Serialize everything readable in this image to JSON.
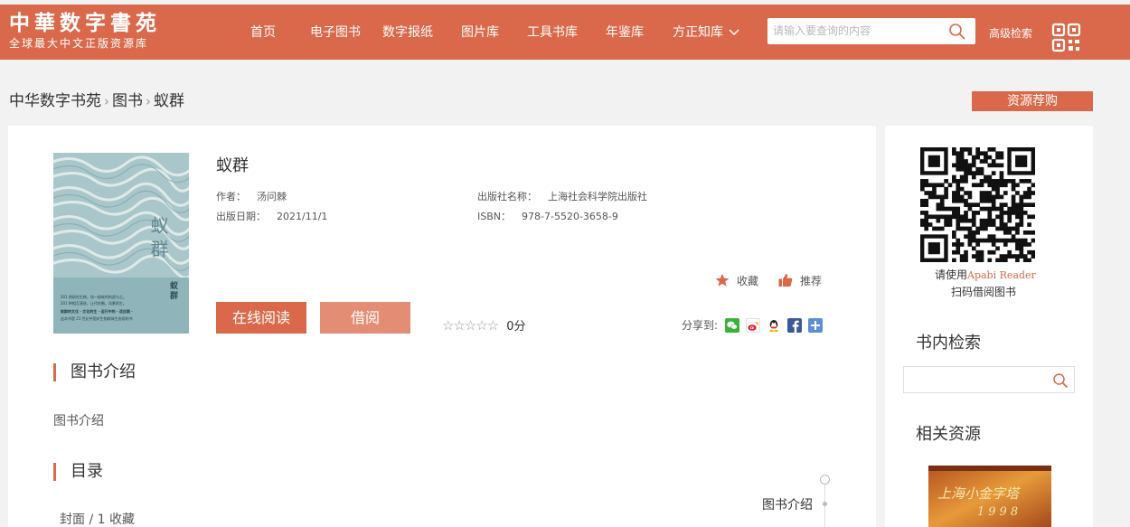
{
  "header": {
    "logo_title": "中華数字書苑",
    "logo_subtitle": "全球最大中文正版资源库",
    "nav": [
      {
        "label": "首页"
      },
      {
        "label": "电子图书"
      },
      {
        "label": "数字报纸"
      },
      {
        "label": "图片库"
      },
      {
        "label": "工具书库"
      },
      {
        "label": "年鉴库"
      },
      {
        "label": "方正知库"
      }
    ],
    "search_placeholder": "请输入要查询的内容",
    "advanced_search": "高级检索"
  },
  "breadcrumb": [
    "中华数字书苑",
    "图书",
    "蚁群"
  ],
  "recommend_button": "资源荐购",
  "book": {
    "title": "蚁群",
    "author_label": "作者：",
    "author": "汤问棘",
    "publisher_label": "出版社名称：",
    "publisher": "上海社会科学院出版社",
    "date_label": "出版日期：",
    "date": "2021/11/1",
    "isbn_label": "ISBN：",
    "isbn": "978-7-5520-3658-9",
    "cover_title": "蚁群",
    "cover_title_small": "蚁群",
    "cover_text": [
      "201 例研究生物，如一枚蚁的构造与之。",
      "201 种相互演进，让代的圈。风景再生。",
      "蚁群的文化 · 文化的生 · 运行中的 · 适应期 ·",
      "这本书是 21 世纪中国对生物群体生态观的书"
    ]
  },
  "actions": {
    "collect": "收藏",
    "recommend": "推荐",
    "read_online": "在线阅读",
    "borrow": "借阅",
    "rating": 0,
    "score": "0分",
    "share_label": "分享到:"
  },
  "sections": {
    "intro_heading": "图书介绍",
    "intro_text": "图书介绍",
    "toc_heading": "目录",
    "toc_first": "封面 / 1 收藏",
    "toc_side": "图书介绍"
  },
  "sidebar": {
    "qr_text_prefix": "请使用",
    "qr_app": "Apabi Reader",
    "qr_text2": "扫码借阅图书",
    "inbook_search": "书内检索",
    "related": "相关资源",
    "related_cover_title": "上海小金字塔",
    "related_cover_year": "1998"
  },
  "colors": {
    "brand": "#d9694a",
    "brand_light": "#e28d74",
    "background": "#f2f2f2"
  },
  "icons": {
    "search": "search-icon",
    "qr": "qr-code-icon",
    "star": "star-icon",
    "thumb": "thumbs-up-icon",
    "wechat": "wechat-icon",
    "weibo": "weibo-icon",
    "qq": "qq-icon",
    "facebook": "facebook-icon",
    "more": "plus-icon"
  }
}
